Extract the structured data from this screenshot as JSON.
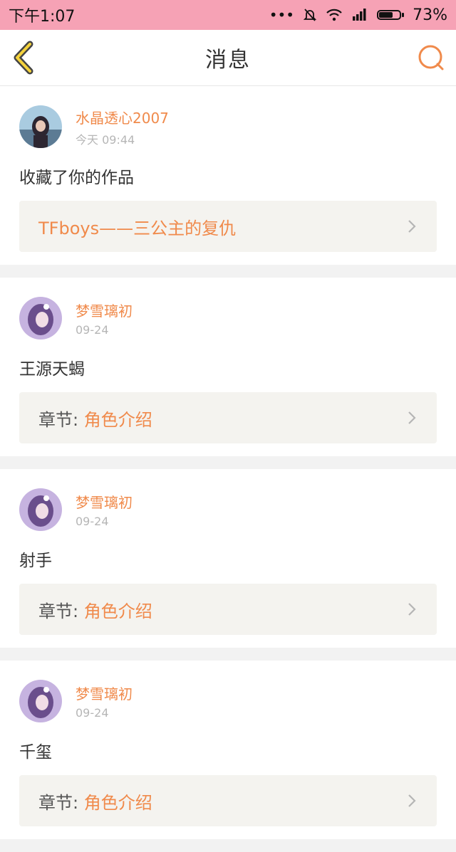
{
  "status": {
    "time": "下午1:07",
    "battery": "73%",
    "battery_level": 0.73,
    "icons": [
      "more-dots-icon",
      "bell-off-icon",
      "wifi-icon",
      "signal-icon",
      "battery-icon"
    ]
  },
  "nav": {
    "title": "消息"
  },
  "colors": {
    "accent": "#f08a4b",
    "statusbar": "#f6a2b5",
    "card_bg": "#f4f3ef"
  },
  "messages": [
    {
      "user": "水晶透心2007",
      "time": "今天 09:44",
      "text": "收藏了你的作品",
      "work_prefix": "",
      "work_title": "TFboys——三公主的复仇"
    },
    {
      "user": "梦雪璃初",
      "time": "09-24",
      "text": "王源天蝎",
      "work_prefix": "章节: ",
      "work_title": "角色介绍"
    },
    {
      "user": "梦雪璃初",
      "time": "09-24",
      "text": "射手",
      "work_prefix": "章节: ",
      "work_title": "角色介绍"
    },
    {
      "user": "梦雪璃初",
      "time": "09-24",
      "text": "千玺",
      "work_prefix": "章节: ",
      "work_title": "角色介绍"
    }
  ]
}
